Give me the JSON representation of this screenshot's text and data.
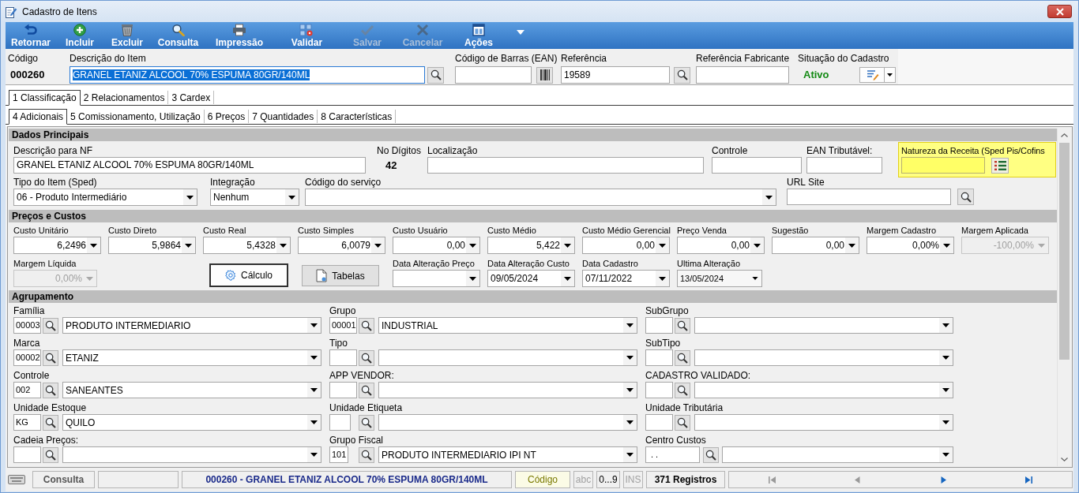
{
  "window": {
    "title": "Cadastro de Itens"
  },
  "toolbar": {
    "buttons": [
      {
        "kind": "return",
        "label": "Retornar",
        "disabled": false
      },
      {
        "kind": "add",
        "label": "Incluir",
        "disabled": false
      },
      {
        "kind": "delete",
        "label": "Excluir",
        "disabled": false
      },
      {
        "kind": "search",
        "label": "Consulta",
        "disabled": false
      },
      {
        "kind": "print",
        "label": "Impressão",
        "disabled": false
      },
      {
        "kind": "validate",
        "label": "Validar",
        "disabled": false
      },
      {
        "kind": "save",
        "label": "Salvar",
        "disabled": true
      },
      {
        "kind": "cancel",
        "label": "Cancelar",
        "disabled": true
      },
      {
        "kind": "actions",
        "label": "Ações",
        "disabled": false
      }
    ]
  },
  "header": {
    "fields": [
      {
        "kind": "code",
        "label": "Código",
        "value": "000260"
      },
      {
        "kind": "text",
        "label": "Descrição do Item",
        "value": "GRANEL ETANIZ ALCOOL 70% ESPUMA 80GR/140ML",
        "focused": true,
        "button": {
          "kind": "search"
        }
      },
      {
        "kind": "text",
        "label": "Código de Barras (EAN)",
        "focused": false,
        "button": {
          "kind": "barcode"
        }
      },
      {
        "kind": "text",
        "label": "Referência",
        "value": "19589",
        "focused": false,
        "button": {
          "kind": "search"
        }
      },
      {
        "kind": "text",
        "label": "Referência Fabricante",
        "focused": false
      },
      {
        "kind": "status",
        "label": "Situação do Cadastro",
        "value": "Ativo"
      }
    ]
  },
  "tab_rows": [
    {
      "tabs": [
        {
          "label": "1 Classificação",
          "selected": true
        },
        {
          "label": "2 Relacionamentos",
          "selected": false
        },
        {
          "label": "3 Cardex",
          "selected": false
        }
      ]
    },
    {
      "tabs": [
        {
          "label": "4 Adicionais",
          "selected": true
        },
        {
          "label": "5 Comissionamento, Utilização",
          "selected": false
        },
        {
          "label": "6 Preços",
          "selected": false
        },
        {
          "label": "7 Quantidades",
          "selected": false
        },
        {
          "label": "8 Características",
          "selected": false
        }
      ]
    }
  ],
  "dados_principais": {
    "title": "Dados Principais",
    "lines": [
      {
        "fields": [
          {
            "kind": "text",
            "label": "Descrição para NF",
            "value": "GRANEL ETANIZ ALCOOL 70% ESPUMA 80GR/140ML",
            "highlighted": false
          },
          {
            "kind": "display",
            "label": "No Dígitos",
            "value": "42"
          },
          {
            "kind": "text",
            "label": "Localização",
            "highlighted": false
          },
          {
            "kind": "text",
            "label": "Controle",
            "highlighted": false
          },
          {
            "kind": "text",
            "label": "EAN Tributável:",
            "highlighted": false
          },
          {
            "kind": "text",
            "label": "Natureza da Receita (Sped Pis/Cofins",
            "highlighted": true,
            "button": {
              "kind": "list"
            }
          }
        ]
      },
      {
        "fields": [
          {
            "kind": "combo",
            "label": "Tipo do Item (Sped)",
            "value": "06 - Produto Intermediário"
          },
          {
            "kind": "combo",
            "label": "Integração",
            "value": "Nenhum"
          },
          {
            "kind": "combo",
            "label": "Código do serviço"
          },
          {
            "kind": "text",
            "label": "URL Site",
            "highlighted": false,
            "button": {
              "kind": "search"
            }
          }
        ]
      }
    ]
  },
  "precos_e_custos": {
    "title": "Preços e Custos",
    "lines": [
      {
        "fields": [
          {
            "kind": "combo",
            "label": "Custo Unitário",
            "value": "6,2496",
            "disabled": false
          },
          {
            "kind": "combo",
            "label": "Custo Direto",
            "value": "5,9864",
            "disabled": false
          },
          {
            "kind": "combo",
            "label": "Custo Real",
            "value": "5,4328",
            "disabled": false
          },
          {
            "kind": "combo",
            "label": "Custo Simples",
            "value": "6,0079",
            "disabled": false
          },
          {
            "kind": "combo",
            "label": "Custo Usuário",
            "value": "0,00",
            "disabled": false
          },
          {
            "kind": "combo",
            "label": "Custo Médio",
            "value": "5,422",
            "disabled": false
          },
          {
            "kind": "combo",
            "label": "Custo Médio Gerencial",
            "value": "0,00",
            "disabled": false
          },
          {
            "kind": "combo",
            "label": "Preço Venda",
            "value": "0,00",
            "disabled": false
          },
          {
            "kind": "combo",
            "label": "Sugestão",
            "value": "0,00",
            "disabled": false
          },
          {
            "kind": "combo",
            "label": "Margem Cadastro",
            "value": "0,00%",
            "disabled": false
          },
          {
            "kind": "combo",
            "label": "Margem Aplicada",
            "value": "-100,00%",
            "disabled": true
          }
        ]
      },
      {
        "fields": [
          {
            "kind": "combo",
            "label": "Margem Líquida",
            "value": "0,00%",
            "disabled": true
          },
          {
            "kind": "button",
            "label": "Cálculo",
            "focused": true
          },
          {
            "kind": "button",
            "label": "Tabelas",
            "focused": false
          },
          {
            "kind": "combo",
            "label": "Data Alteração Preço",
            "disabled": false
          },
          {
            "kind": "combo",
            "label": "Data Alteração Custo",
            "value": "09/05/2024",
            "disabled": false
          },
          {
            "kind": "combo",
            "label": "Data Cadastro",
            "value": "07/11/2022",
            "disabled": false
          },
          {
            "kind": "date",
            "label": "Ultima Alteração",
            "value": "13/05/2024",
            "disabled": false
          }
        ]
      }
    ]
  },
  "agrupamento": {
    "title": "Agrupamento",
    "rows": [
      [
        {
          "label": "Família",
          "code": "00003",
          "value": "PRODUTO INTERMEDIARIO"
        },
        {
          "label": "Grupo",
          "code": "00001",
          "value": "INDUSTRIAL"
        },
        {
          "label": "SubGrupo"
        }
      ],
      [
        {
          "label": "Marca",
          "code": "00002",
          "value": "ETANIZ"
        },
        {
          "label": "Tipo"
        },
        {
          "label": "SubTipo"
        }
      ],
      [
        {
          "label": "Controle",
          "code": "002",
          "value": "SANEANTES"
        },
        {
          "label": "APP VENDOR:"
        },
        {
          "label": "CADASTRO VALIDADO:"
        }
      ],
      [
        {
          "label": "Unidade Estoque",
          "code": "KG",
          "value": "QUILO"
        },
        {
          "label": "Unidade Etiqueta"
        },
        {
          "label": "Unidade Tributária"
        }
      ],
      [
        {
          "label": "Cadeia Preços:"
        },
        {
          "label": "Grupo Fiscal",
          "code": "101",
          "value": "PRODUTO INTERMEDIARIO IPI NT"
        },
        {
          "label": "Centro Custos",
          "code": ". ."
        }
      ]
    ]
  },
  "status_bar": {
    "mode": "Consulta",
    "record": "000260 - GRANEL ETANIZ ALCOOL 70% ESPUMA 80GR/140ML",
    "sort_field": "Código",
    "indicators": [
      {
        "label": "abc",
        "active": false
      },
      {
        "label": "0...9",
        "active": true
      },
      {
        "label": "INS",
        "active": false
      }
    ],
    "count": "371 Registros",
    "navigation": [
      {
        "kind": "first",
        "disabled": true
      },
      {
        "kind": "previous",
        "disabled": true
      },
      {
        "kind": "next",
        "disabled": false
      },
      {
        "kind": "last",
        "disabled": false
      }
    ]
  }
}
